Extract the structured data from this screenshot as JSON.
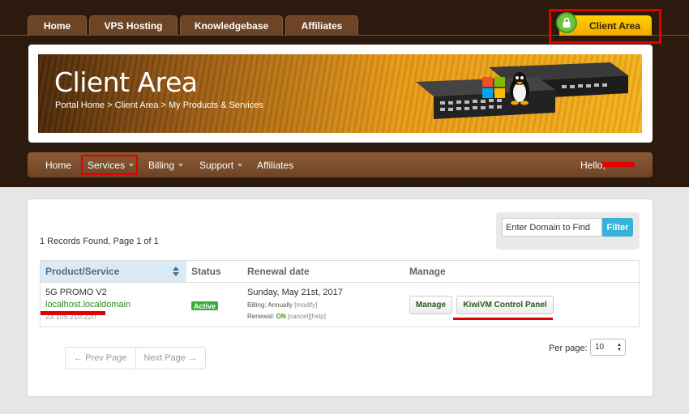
{
  "top_tabs": [
    "Home",
    "VPS Hosting",
    "Knowledgebase",
    "Affiliates"
  ],
  "client_tab": {
    "label": "Client Area",
    "icon": "lock-icon"
  },
  "banner": {
    "title": "Client Area",
    "breadcrumb": "Portal Home > Client Area > My Products & Services"
  },
  "nav": {
    "items": [
      "Home",
      "Services",
      "Billing",
      "Support",
      "Affiliates"
    ],
    "greeting": "Hello, "
  },
  "records_text": "1 Records Found, Page 1 of 1",
  "search": {
    "placeholder": "Enter Domain to Find",
    "filter_label": "Filter"
  },
  "table": {
    "headers": [
      "Product/Service",
      "Status",
      "Renewal date",
      "Manage"
    ],
    "row": {
      "product": "5G PROMO V2",
      "domain": "localhost.localdomain",
      "ip": "23.105.210.220",
      "status": "Active",
      "renewal_date": "Sunday, May 21st, 2017",
      "billing_label": "Billing: Annually",
      "modify_link": "[modify]",
      "renewal_label": "Renewal:",
      "renewal_state": "ON",
      "cancel_link": "[cancel]",
      "help_link": "[help]",
      "manage_button": "Manage",
      "panel_button": "KiwiVM Control Panel"
    }
  },
  "pagination": {
    "prev": "← Prev Page",
    "next": "Next Page →"
  },
  "per_page": {
    "label": "Per page:",
    "value": "10"
  },
  "colors": {
    "header_bg": "#2c1a0e",
    "accent_gold": "#f6b21b",
    "filter_blue": "#38b2d8",
    "active_green": "#3daa3d",
    "highlight_red": "#e00000"
  }
}
